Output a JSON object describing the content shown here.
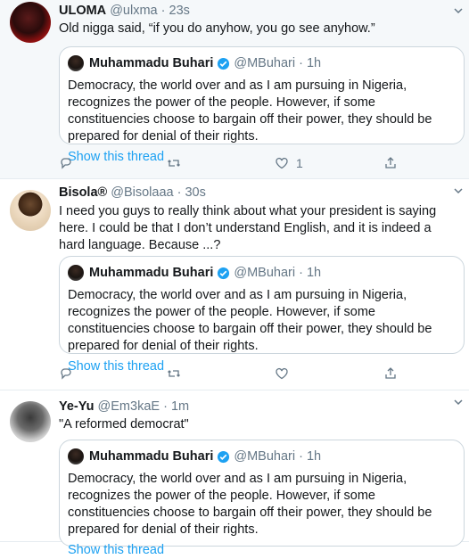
{
  "tweets": [
    {
      "name": "ULOMA",
      "handle": "@ulxma",
      "time": "23s",
      "text": "Old nigga said, “if you do anyhow, you go see anyhow.”",
      "quote": {
        "name": "Muhammadu Buhari",
        "handle": "@MBuhari",
        "time": "1h",
        "text": "Democracy, the world over and as I am pursuing in Nigeria, recognizes the power of the people. However, if some constituencies choose to bargain off their power, they should be prepared for denial of their rights.",
        "link": "Show this thread"
      },
      "like_count": "1"
    },
    {
      "name": "Bisola®",
      "handle": "@Bisolaaa",
      "time": "30s",
      "text": "I need you guys to really think about what your president is saying here. I could be that I don’t understand English, and it is indeed a hard language. Because ...?",
      "quote": {
        "name": "Muhammadu Buhari",
        "handle": "@MBuhari",
        "time": "1h",
        "text": "Democracy, the world over and as I am pursuing in Nigeria, recognizes the power of the people. However, if some constituencies choose to bargain off their power, they should be prepared for denial of their rights.",
        "link": "Show this thread"
      },
      "like_count": ""
    },
    {
      "name": "Ye-Yu",
      "handle": "@Em3kaE",
      "time": "1m",
      "text": "\"A reformed democrat\"",
      "quote": {
        "name": "Muhammadu Buhari",
        "handle": "@MBuhari",
        "time": "1h",
        "text": "Democracy, the world over and as I am pursuing in Nigeria, recognizes the power of the people. However, if some constituencies choose to bargain off their power, they should be prepared for denial of their rights.",
        "link": "Show this thread"
      },
      "like_count": ""
    }
  ],
  "separator": "·",
  "icons": {
    "reply": "reply-icon",
    "retweet": "retweet-icon",
    "like": "like-icon",
    "share": "share-icon",
    "caret": "chevron-down-icon",
    "verified": "verified-badge-icon"
  },
  "colors": {
    "link": "#1da1f2",
    "muted": "#657786",
    "border": "#ccd6dd",
    "hover_bg": "#f5f8fa"
  }
}
